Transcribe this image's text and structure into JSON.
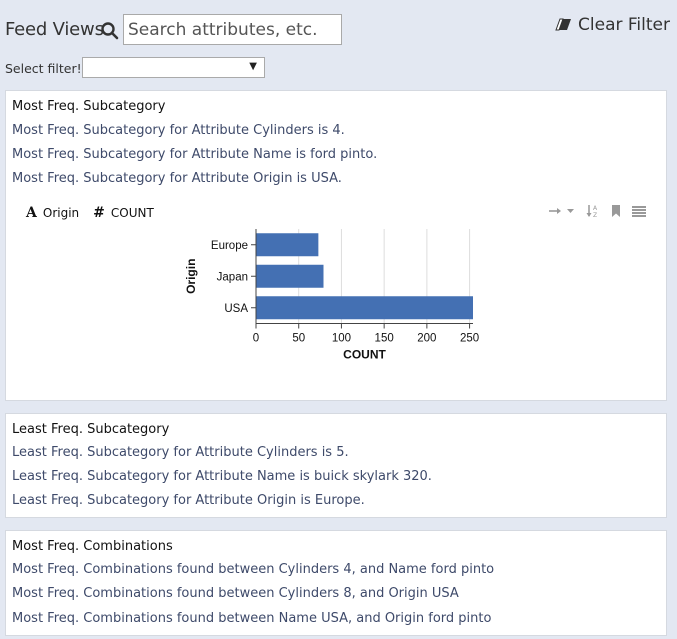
{
  "header": {
    "title": "Feed Views",
    "search_placeholder": "Search attributes, etc.",
    "clear_filter": "Clear Filter",
    "select_label": "Select filter!",
    "select_value": ""
  },
  "cards": [
    {
      "title": "Most Freq. Subcategory",
      "lines": [
        "Most Freq. Subcategory for Attribute Cylinders is 4.",
        "Most Freq. Subcategory for Attribute Name is ford pinto.",
        "Most Freq. Subcategory for Attribute Origin is USA."
      ]
    },
    {
      "title": "Least Freq. Subcategory",
      "lines": [
        "Least Freq. Subcategory for Attribute Cylinders is 5.",
        "Least Freq. Subcategory for Attribute Name is buick skylark 320.",
        "Least Freq. Subcategory for Attribute Origin is Europe."
      ]
    },
    {
      "title": "Most Freq. Combinations",
      "lines": [
        "Most Freq. Combinations found between Cylinders 4, and Name ford pinto",
        "Most Freq. Combinations found between Cylinders 8, and Origin USA",
        "Most Freq. Combinations found between Name USA, and Origin ford pinto"
      ]
    }
  ],
  "chart_header": {
    "field1_type": "A",
    "field1_name": "Origin",
    "field2_type": "#",
    "field2_name": "COUNT"
  },
  "chart_data": {
    "type": "bar",
    "orientation": "horizontal",
    "categories": [
      "Europe",
      "Japan",
      "USA"
    ],
    "values": [
      73,
      79,
      254
    ],
    "xlabel": "COUNT",
    "ylabel": "Origin",
    "xlim": [
      0,
      254
    ],
    "xticks": [
      0,
      50,
      100,
      150,
      200,
      250
    ],
    "bar_color": "#4470b3",
    "grid": true
  },
  "colors": {
    "background": "#e3e8f2",
    "line_text": "#3e4a6a",
    "bar": "#4470b3"
  }
}
